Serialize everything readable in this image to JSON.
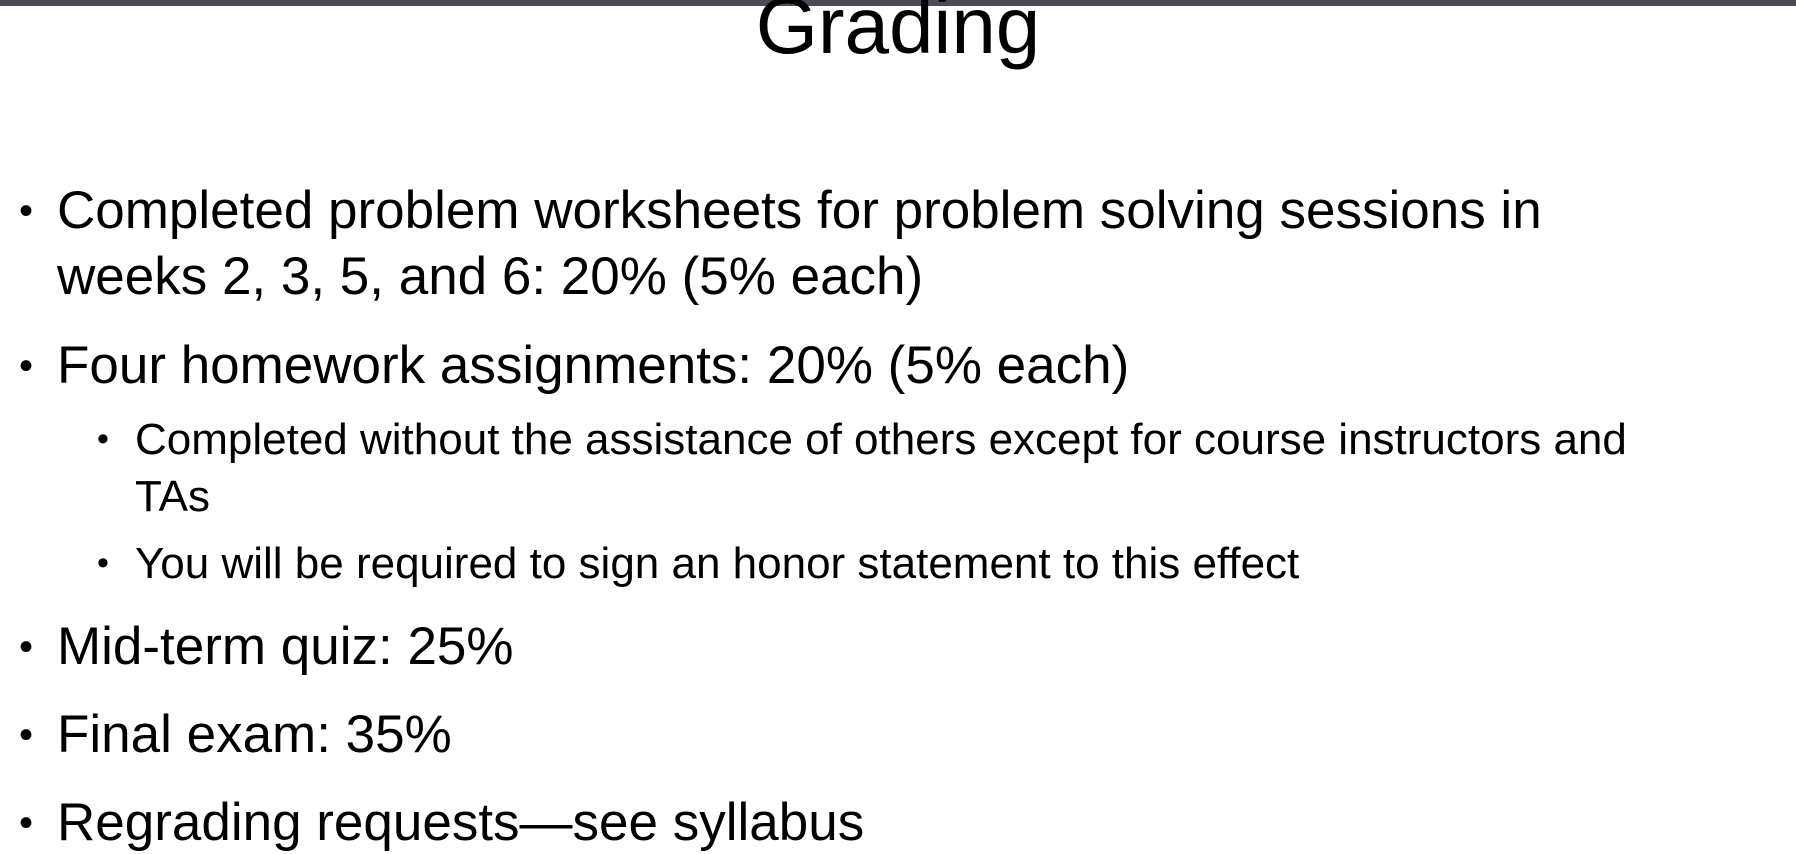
{
  "slide": {
    "title": "Grading",
    "bullets": [
      {
        "line1": "Completed problem worksheets for problem solving sessions in",
        "line2": "weeks 2, 3, 5, and 6: 20% (5% each)"
      },
      {
        "text": "Four homework assignments: 20% (5% each)",
        "sub": [
          {
            "line1": "Completed without the assistance of others except for course instructors and",
            "line2": "TAs"
          },
          {
            "text": "You will be required to sign an honor statement to this effect"
          }
        ]
      },
      {
        "text": "Mid-term quiz:  25%"
      },
      {
        "text": "Final exam: 35%"
      },
      {
        "text": "Regrading requests—see syllabus"
      }
    ]
  },
  "bullet_glyph": "•"
}
